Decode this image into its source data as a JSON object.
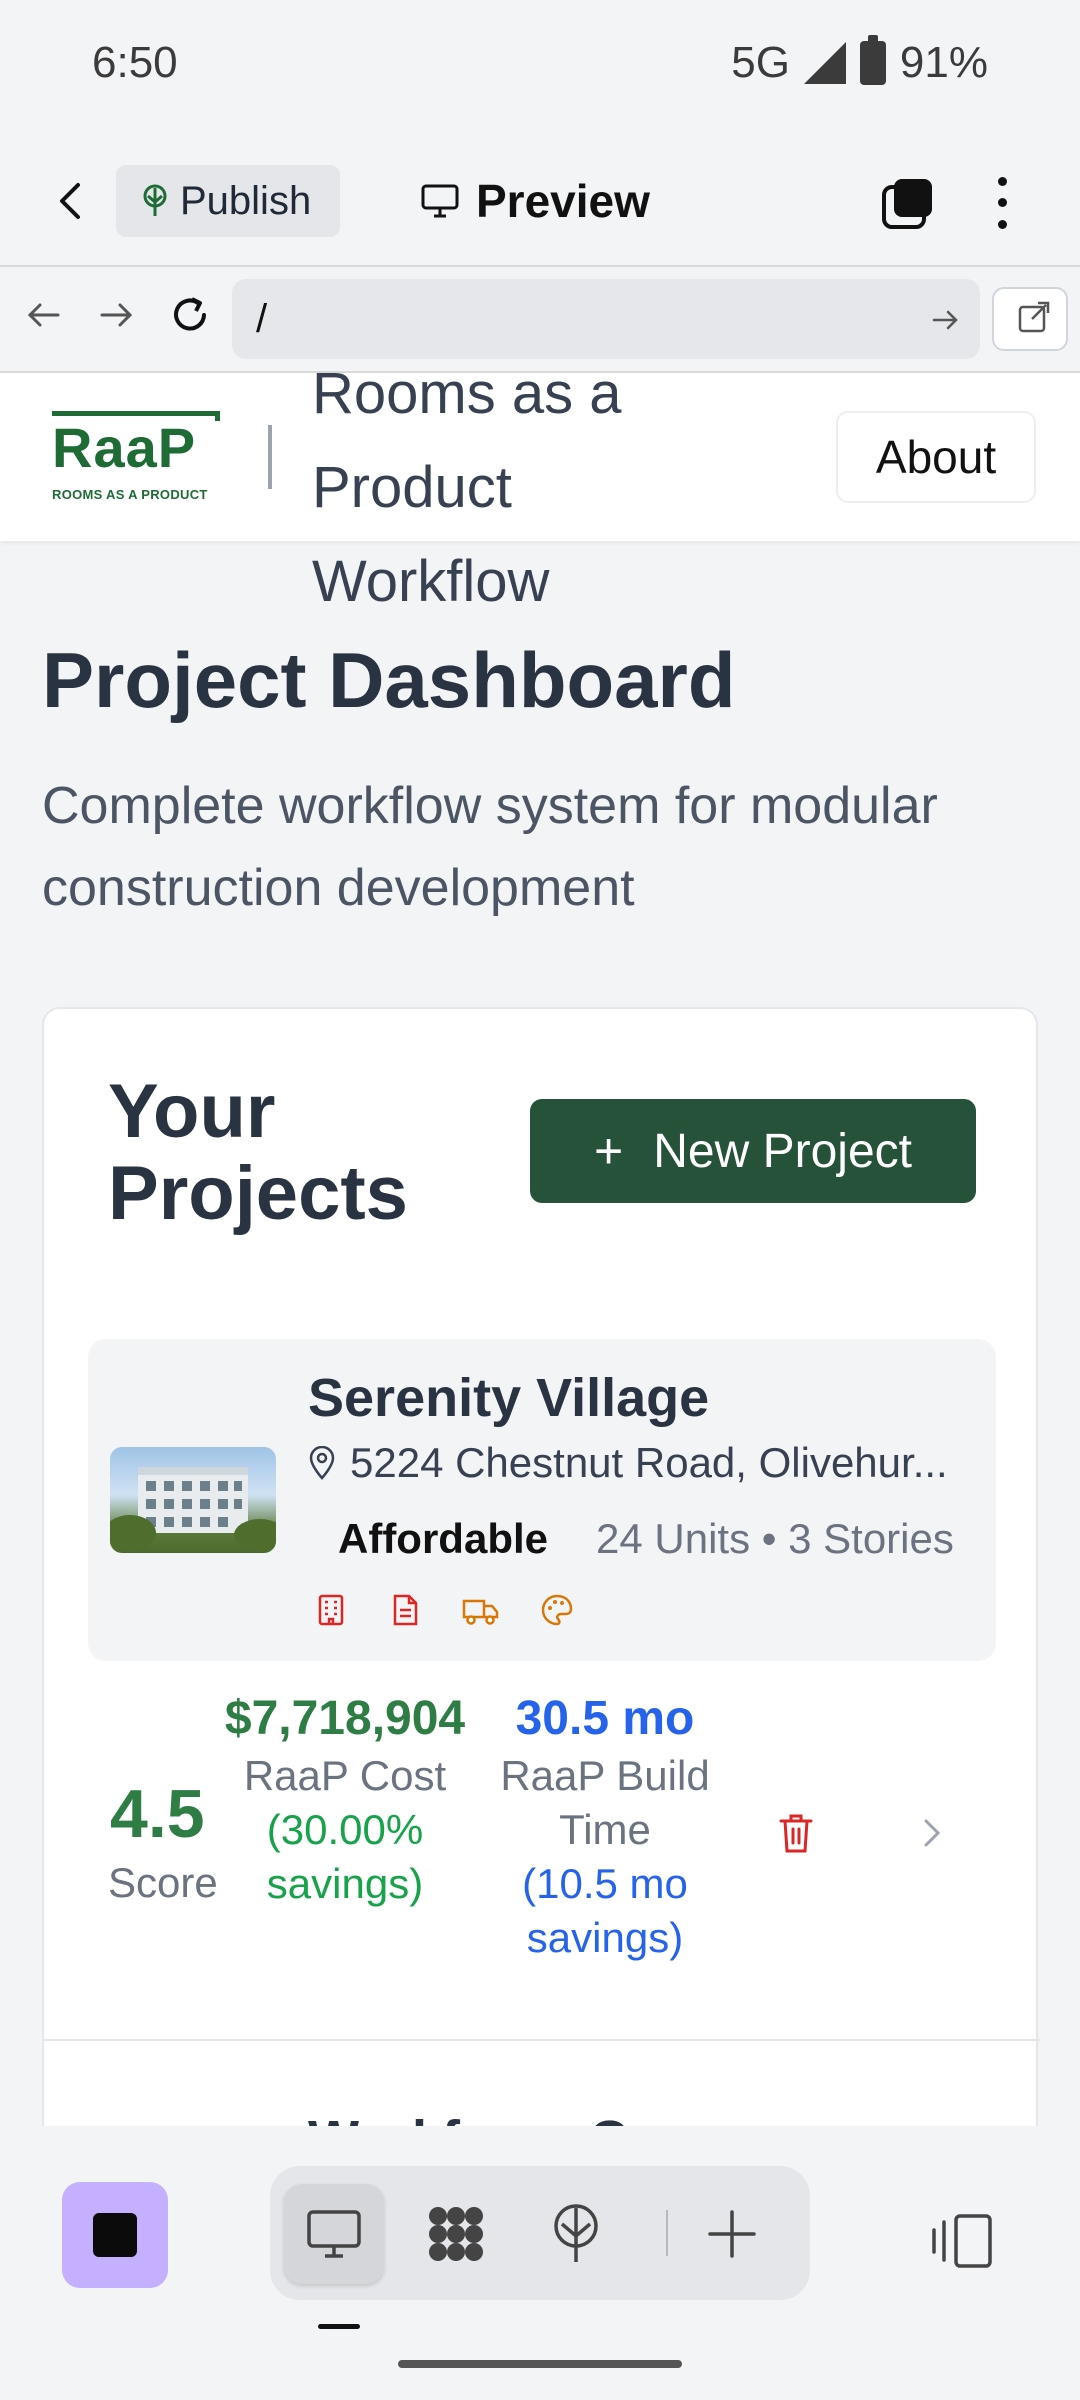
{
  "status_bar": {
    "time": "6:50",
    "network": "5G",
    "battery": "91%"
  },
  "toolbar": {
    "publish_label": "Publish",
    "preview_label": "Preview"
  },
  "url_bar": {
    "value": "/"
  },
  "site_header": {
    "logo_main": "RaaP",
    "logo_sub": "ROOMS AS A PRODUCT",
    "title": "Rooms as a Product Workflow",
    "about_label": "About"
  },
  "page": {
    "title": "Project Dashboard",
    "subtitle": "Complete workflow system for modular construction development"
  },
  "projects": {
    "heading": "Your Projects",
    "new_project_label": "New Project",
    "items": [
      {
        "name": "Serenity Village",
        "address": "5224 Chestnut Road, Olivehur...",
        "type": "Affordable",
        "meta": "24 Units • 3 Stories",
        "score": "4.5",
        "score_label": "Score",
        "cost": "$7,718,904",
        "cost_label": "RaaP Cost",
        "cost_savings": "(30.00% savings)",
        "build_time": "30.5 mo",
        "build_time_label": "RaaP Build Time",
        "build_time_savings": "(10.5 mo savings)"
      }
    ],
    "next_item_name": "Workforce Commons"
  },
  "colors": {
    "brand_green": "#255239",
    "score_green": "#2e7d45",
    "savings_green": "#16a34a",
    "time_blue": "#2563eb",
    "delete_red": "#dc2626",
    "agent_purple": "#c4b0ff"
  },
  "icons": {
    "toolbar": [
      "back-arrow-icon",
      "sprout-icon",
      "monitor-icon",
      "tabs-icon",
      "more-vertical-icon"
    ],
    "url": [
      "arrow-left-icon",
      "arrow-right-icon",
      "refresh-icon",
      "arrow-go-icon",
      "external-link-icon"
    ],
    "status": [
      "building-icon",
      "document-icon",
      "truck-icon",
      "palette-icon"
    ],
    "bottom": [
      "stop-icon",
      "desktop-icon",
      "grid-icon",
      "sprout-icon",
      "plus-icon",
      "split-view-icon"
    ]
  }
}
